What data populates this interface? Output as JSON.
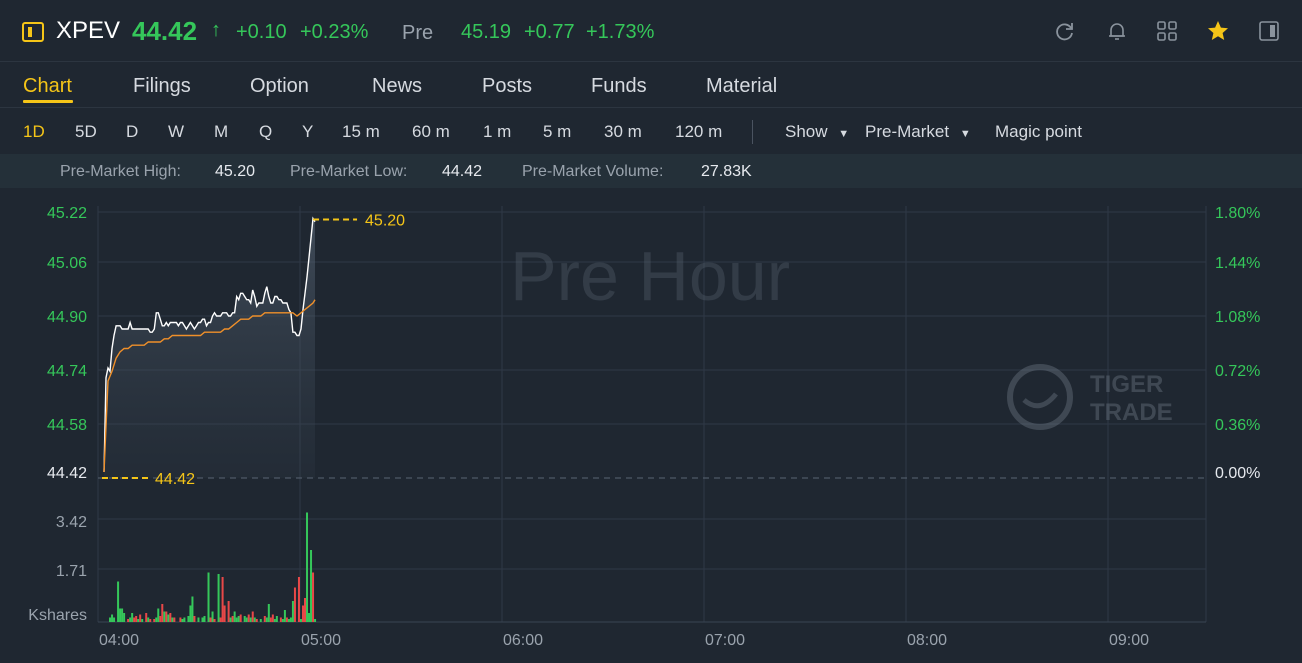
{
  "header": {
    "ticker": "XPEV",
    "price": "44.42",
    "price_arrow": "↑",
    "change": "+0.10",
    "change_pct": "+0.23%",
    "session_label": "Pre",
    "session_price": "45.19",
    "session_change": "+0.77",
    "session_change_pct": "+1.73%",
    "icons": [
      "refresh-icon",
      "bell-icon",
      "grid-icon",
      "star-icon",
      "panel-icon"
    ],
    "colors": {
      "up": "#35c75a",
      "down": "#e84848",
      "accent": "#f5c518",
      "background": "#1f2731"
    }
  },
  "tabs": [
    "Chart",
    "Filings",
    "Option",
    "News",
    "Posts",
    "Funds",
    "Material"
  ],
  "active_tab": "Chart",
  "periods": [
    "1D",
    "5D",
    "D",
    "W",
    "M",
    "Q",
    "Y",
    "15 m",
    "60 m",
    "1 m",
    "5 m",
    "30 m",
    "120 m"
  ],
  "active_period": "1D",
  "options": {
    "show": "Show",
    "session": "Pre-Market",
    "magic": "Magic point"
  },
  "stats": [
    {
      "label": "Pre-Market High:",
      "value": "45.20"
    },
    {
      "label": "Pre-Market Low:",
      "value": "44.42"
    },
    {
      "label": "Pre-Market Volume:",
      "value": "27.83K"
    }
  ],
  "chart_data": {
    "type": "line",
    "watermark": "Pre Hour",
    "brand": [
      "TIGER",
      "TRADE"
    ],
    "x_ticks": [
      "04:00",
      "05:00",
      "06:00",
      "07:00",
      "08:00",
      "09:00"
    ],
    "y_ticks": [
      "45.22",
      "45.06",
      "44.90",
      "44.74",
      "44.58",
      "44.42"
    ],
    "pct_ticks": [
      "1.80%",
      "1.44%",
      "1.08%",
      "0.72%",
      "0.36%",
      "0.00%"
    ],
    "ylim": [
      44.42,
      45.22
    ],
    "high_label": "45.20",
    "low_label": "44.42",
    "volume_unit": "Kshares",
    "volume_ticks": [
      "3.42",
      "1.71"
    ],
    "volume_max": 4.0,
    "series": [
      {
        "values": [
          [
            0,
            44.42
          ],
          [
            2,
            44.71
          ],
          [
            4,
            44.74
          ],
          [
            6,
            44.73
          ],
          [
            8,
            44.8
          ],
          [
            10,
            44.84
          ],
          [
            12,
            44.87
          ],
          [
            14,
            44.87
          ],
          [
            16,
            44.87
          ],
          [
            18,
            44.86
          ],
          [
            20,
            44.86
          ],
          [
            22,
            44.86
          ],
          [
            24,
            44.86
          ],
          [
            26,
            44.88
          ],
          [
            28,
            44.86
          ],
          [
            30,
            44.86
          ],
          [
            32,
            44.86
          ],
          [
            34,
            44.86
          ],
          [
            36,
            44.86
          ],
          [
            38,
            44.86
          ],
          [
            40,
            44.86
          ],
          [
            42,
            44.86
          ],
          [
            44,
            44.86
          ],
          [
            46,
            44.85
          ],
          [
            48,
            44.85
          ],
          [
            50,
            44.86
          ],
          [
            52,
            44.91
          ],
          [
            54,
            44.91
          ],
          [
            56,
            44.89
          ],
          [
            58,
            44.87
          ],
          [
            60,
            44.87
          ],
          [
            62,
            44.88
          ],
          [
            64,
            44.87
          ],
          [
            66,
            44.88
          ],
          [
            68,
            44.88
          ],
          [
            70,
            44.88
          ],
          [
            72,
            44.88
          ],
          [
            74,
            44.87
          ],
          [
            76,
            44.88
          ],
          [
            78,
            44.88
          ],
          [
            80,
            44.87
          ],
          [
            82,
            44.86
          ],
          [
            84,
            44.87
          ],
          [
            86,
            44.88
          ],
          [
            88,
            44.87
          ],
          [
            90,
            44.86
          ],
          [
            92,
            44.87
          ],
          [
            94,
            44.88
          ],
          [
            96,
            44.88
          ],
          [
            98,
            44.89
          ],
          [
            100,
            44.89
          ],
          [
            102,
            44.87
          ],
          [
            104,
            44.88
          ],
          [
            106,
            44.88
          ],
          [
            108,
            44.9
          ],
          [
            110,
            44.91
          ],
          [
            112,
            44.9
          ],
          [
            114,
            44.9
          ],
          [
            116,
            44.9
          ],
          [
            118,
            44.91
          ],
          [
            120,
            44.91
          ],
          [
            122,
            44.91
          ],
          [
            124,
            44.9
          ],
          [
            126,
            44.9
          ],
          [
            128,
            44.91
          ],
          [
            130,
            44.91
          ],
          [
            132,
            44.96
          ],
          [
            134,
            44.95
          ],
          [
            136,
            44.97
          ],
          [
            138,
            44.97
          ],
          [
            140,
            44.96
          ],
          [
            142,
            44.95
          ],
          [
            144,
            44.95
          ],
          [
            146,
            44.94
          ],
          [
            148,
            44.98
          ],
          [
            150,
            44.96
          ],
          [
            152,
            44.93
          ],
          [
            154,
            44.94
          ],
          [
            156,
            44.94
          ],
          [
            158,
            44.94
          ],
          [
            160,
            44.97
          ],
          [
            162,
            44.99
          ],
          [
            164,
            44.96
          ],
          [
            166,
            44.94
          ],
          [
            168,
            44.94
          ],
          [
            170,
            44.96
          ],
          [
            172,
            44.96
          ],
          [
            174,
            44.95
          ],
          [
            176,
            44.95
          ],
          [
            178,
            44.94
          ],
          [
            180,
            44.94
          ],
          [
            182,
            44.94
          ],
          [
            184,
            44.92
          ],
          [
            186,
            44.91
          ],
          [
            188,
            44.85
          ],
          [
            190,
            44.85
          ],
          [
            192,
            44.84
          ],
          [
            194,
            44.84
          ],
          [
            196,
            44.86
          ],
          [
            198,
            44.92
          ],
          [
            200,
            44.97
          ],
          [
            202,
            45.02
          ],
          [
            204,
            45.08
          ],
          [
            206,
            45.14
          ],
          [
            208,
            45.2
          ],
          [
            210,
            45.19
          ]
        ]
      },
      {
        "values": [
          [
            0,
            44.42
          ],
          [
            4,
            44.7
          ],
          [
            8,
            44.73
          ],
          [
            12,
            44.77
          ],
          [
            16,
            44.79
          ],
          [
            20,
            44.8
          ],
          [
            24,
            44.8
          ],
          [
            28,
            44.81
          ],
          [
            32,
            44.81
          ],
          [
            36,
            44.81
          ],
          [
            40,
            44.81
          ],
          [
            44,
            44.82
          ],
          [
            48,
            44.82
          ],
          [
            52,
            44.82
          ],
          [
            56,
            44.82
          ],
          [
            60,
            44.83
          ],
          [
            64,
            44.83
          ],
          [
            68,
            44.84
          ],
          [
            72,
            44.84
          ],
          [
            76,
            44.84
          ],
          [
            80,
            44.84
          ],
          [
            84,
            44.84
          ],
          [
            88,
            44.84
          ],
          [
            92,
            44.84
          ],
          [
            96,
            44.84
          ],
          [
            100,
            44.85
          ],
          [
            104,
            44.85
          ],
          [
            108,
            44.85
          ],
          [
            112,
            44.85
          ],
          [
            116,
            44.85
          ],
          [
            120,
            44.86
          ],
          [
            124,
            44.86
          ],
          [
            128,
            44.87
          ],
          [
            132,
            44.88
          ],
          [
            136,
            44.89
          ],
          [
            140,
            44.89
          ],
          [
            144,
            44.89
          ],
          [
            148,
            44.9
          ],
          [
            152,
            44.9
          ],
          [
            156,
            44.9
          ],
          [
            160,
            44.91
          ],
          [
            164,
            44.91
          ],
          [
            168,
            44.91
          ],
          [
            172,
            44.91
          ],
          [
            176,
            44.91
          ],
          [
            180,
            44.91
          ],
          [
            184,
            44.91
          ],
          [
            188,
            44.91
          ],
          [
            192,
            44.9
          ],
          [
            196,
            44.91
          ],
          [
            200,
            44.92
          ],
          [
            204,
            44.93
          ],
          [
            208,
            44.94
          ],
          [
            210,
            44.95
          ]
        ]
      }
    ],
    "volume": [
      [
        6,
        0.15,
        "g"
      ],
      [
        8,
        0.25,
        "g"
      ],
      [
        10,
        0.15,
        "g"
      ],
      [
        14,
        1.35,
        "g"
      ],
      [
        16,
        0.45,
        "g"
      ],
      [
        18,
        0.45,
        "g"
      ],
      [
        20,
        0.3,
        "g"
      ],
      [
        24,
        0.1,
        "r"
      ],
      [
        26,
        0.15,
        "g"
      ],
      [
        28,
        0.3,
        "g"
      ],
      [
        30,
        0.15,
        "r"
      ],
      [
        32,
        0.2,
        "r"
      ],
      [
        34,
        0.1,
        "g"
      ],
      [
        36,
        0.25,
        "r"
      ],
      [
        38,
        0.1,
        "g"
      ],
      [
        42,
        0.3,
        "r"
      ],
      [
        44,
        0.15,
        "g"
      ],
      [
        46,
        0.1,
        "r"
      ],
      [
        50,
        0.1,
        "r"
      ],
      [
        52,
        0.15,
        "g"
      ],
      [
        54,
        0.45,
        "g"
      ],
      [
        56,
        0.2,
        "r"
      ],
      [
        58,
        0.6,
        "r"
      ],
      [
        60,
        0.35,
        "g"
      ],
      [
        62,
        0.35,
        "r"
      ],
      [
        64,
        0.25,
        "g"
      ],
      [
        66,
        0.3,
        "r"
      ],
      [
        68,
        0.15,
        "g"
      ],
      [
        70,
        0.15,
        "r"
      ],
      [
        76,
        0.15,
        "r"
      ],
      [
        78,
        0.1,
        "g"
      ],
      [
        80,
        0.15,
        "g"
      ],
      [
        84,
        0.2,
        "g"
      ],
      [
        86,
        0.55,
        "g"
      ],
      [
        88,
        0.85,
        "g"
      ],
      [
        90,
        0.2,
        "r"
      ],
      [
        94,
        0.15,
        "g"
      ],
      [
        98,
        0.15,
        "g"
      ],
      [
        100,
        0.2,
        "g"
      ],
      [
        104,
        1.65,
        "g"
      ],
      [
        106,
        0.15,
        "r"
      ],
      [
        108,
        0.35,
        "g"
      ],
      [
        110,
        0.1,
        "r"
      ],
      [
        114,
        1.6,
        "g"
      ],
      [
        116,
        0.15,
        "r"
      ],
      [
        118,
        1.5,
        "r"
      ],
      [
        120,
        0.55,
        "r"
      ],
      [
        124,
        0.7,
        "r"
      ],
      [
        126,
        0.15,
        "g"
      ],
      [
        128,
        0.2,
        "r"
      ],
      [
        130,
        0.35,
        "g"
      ],
      [
        132,
        0.15,
        "g"
      ],
      [
        134,
        0.2,
        "g"
      ],
      [
        136,
        0.25,
        "r"
      ],
      [
        140,
        0.2,
        "g"
      ],
      [
        142,
        0.15,
        "g"
      ],
      [
        144,
        0.25,
        "r"
      ],
      [
        146,
        0.15,
        "g"
      ],
      [
        148,
        0.35,
        "r"
      ],
      [
        150,
        0.15,
        "g"
      ],
      [
        152,
        0.1,
        "r"
      ],
      [
        156,
        0.1,
        "g"
      ],
      [
        160,
        0.2,
        "r"
      ],
      [
        162,
        0.15,
        "g"
      ],
      [
        164,
        0.6,
        "g"
      ],
      [
        166,
        0.15,
        "r"
      ],
      [
        168,
        0.25,
        "r"
      ],
      [
        170,
        0.1,
        "g"
      ],
      [
        172,
        0.2,
        "g"
      ],
      [
        176,
        0.15,
        "r"
      ],
      [
        178,
        0.1,
        "g"
      ],
      [
        180,
        0.4,
        "g"
      ],
      [
        182,
        0.15,
        "r"
      ],
      [
        184,
        0.1,
        "g"
      ],
      [
        186,
        0.15,
        "g"
      ],
      [
        188,
        0.7,
        "g"
      ],
      [
        190,
        1.15,
        "r"
      ],
      [
        194,
        1.5,
        "r"
      ],
      [
        196,
        0.1,
        "g"
      ],
      [
        198,
        0.55,
        "r"
      ],
      [
        200,
        0.8,
        "r"
      ],
      [
        202,
        3.65,
        "g"
      ],
      [
        204,
        0.3,
        "g"
      ],
      [
        206,
        2.4,
        "g"
      ],
      [
        208,
        1.65,
        "r"
      ],
      [
        210,
        0.1,
        "g"
      ]
    ]
  }
}
